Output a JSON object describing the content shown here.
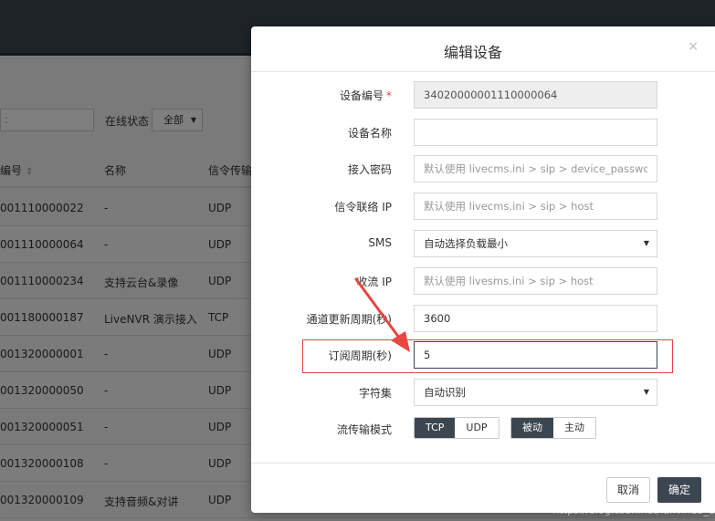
{
  "background": {
    "filter": {
      "search_value": ":",
      "status_label": "在线状态",
      "status_value": "全部"
    },
    "table": {
      "headers": [
        "编号",
        "名称",
        "信令传输"
      ],
      "rows": [
        {
          "id": "001110000022",
          "name": "-",
          "transport": "UDP"
        },
        {
          "id": "001110000064",
          "name": "-",
          "transport": "UDP"
        },
        {
          "id": "001110000234",
          "name": "支持云台&录像",
          "transport": "UDP"
        },
        {
          "id": "001180000187",
          "name": "LiveNVR 演示接入",
          "transport": "TCP"
        },
        {
          "id": "001320000001",
          "name": "-",
          "transport": "UDP"
        },
        {
          "id": "001320000050",
          "name": "-",
          "transport": "UDP"
        },
        {
          "id": "001320000051",
          "name": "-",
          "transport": "UDP"
        },
        {
          "id": "001320000108",
          "name": "-",
          "transport": "UDP"
        },
        {
          "id": "001320000109",
          "name": "支持音频&对讲",
          "transport": "UDP"
        }
      ]
    }
  },
  "modal": {
    "title": "编辑设备",
    "close": "×",
    "fields": {
      "device_id": {
        "label": "设备编号",
        "required": "*",
        "value": "34020000001110000064"
      },
      "device_name": {
        "label": "设备名称",
        "value": ""
      },
      "password": {
        "label": "接入密码",
        "placeholder": "默认使用 livecms.ini > sip > device_password"
      },
      "signal_ip": {
        "label": "信令联络 IP",
        "placeholder": "默认使用 livecms.ini > sip > host"
      },
      "sms": {
        "label": "SMS",
        "value": "自动选择负载最小"
      },
      "stream_ip": {
        "label": "收流 IP",
        "placeholder": "默认使用 livesms.ini > sip > host"
      },
      "channel_period": {
        "label": "通道更新周期(秒)",
        "value": "3600"
      },
      "subscribe_period": {
        "label": "订阅周期(秒)",
        "value": "5"
      },
      "charset": {
        "label": "字符集",
        "value": "自动识别"
      },
      "transport_mode": {
        "label": "流传输模式",
        "protocol": [
          "TCP",
          "UDP"
        ],
        "direction": [
          "被动",
          "主动"
        ]
      }
    },
    "footer": {
      "cancel": "取消",
      "ok": "确定"
    }
  },
  "watermark": "https://blog.csdn.net/lanvin13_1",
  "colors": {
    "accent": "#3c4650",
    "highlight": "#e8463f",
    "required": "#dd4b39"
  }
}
